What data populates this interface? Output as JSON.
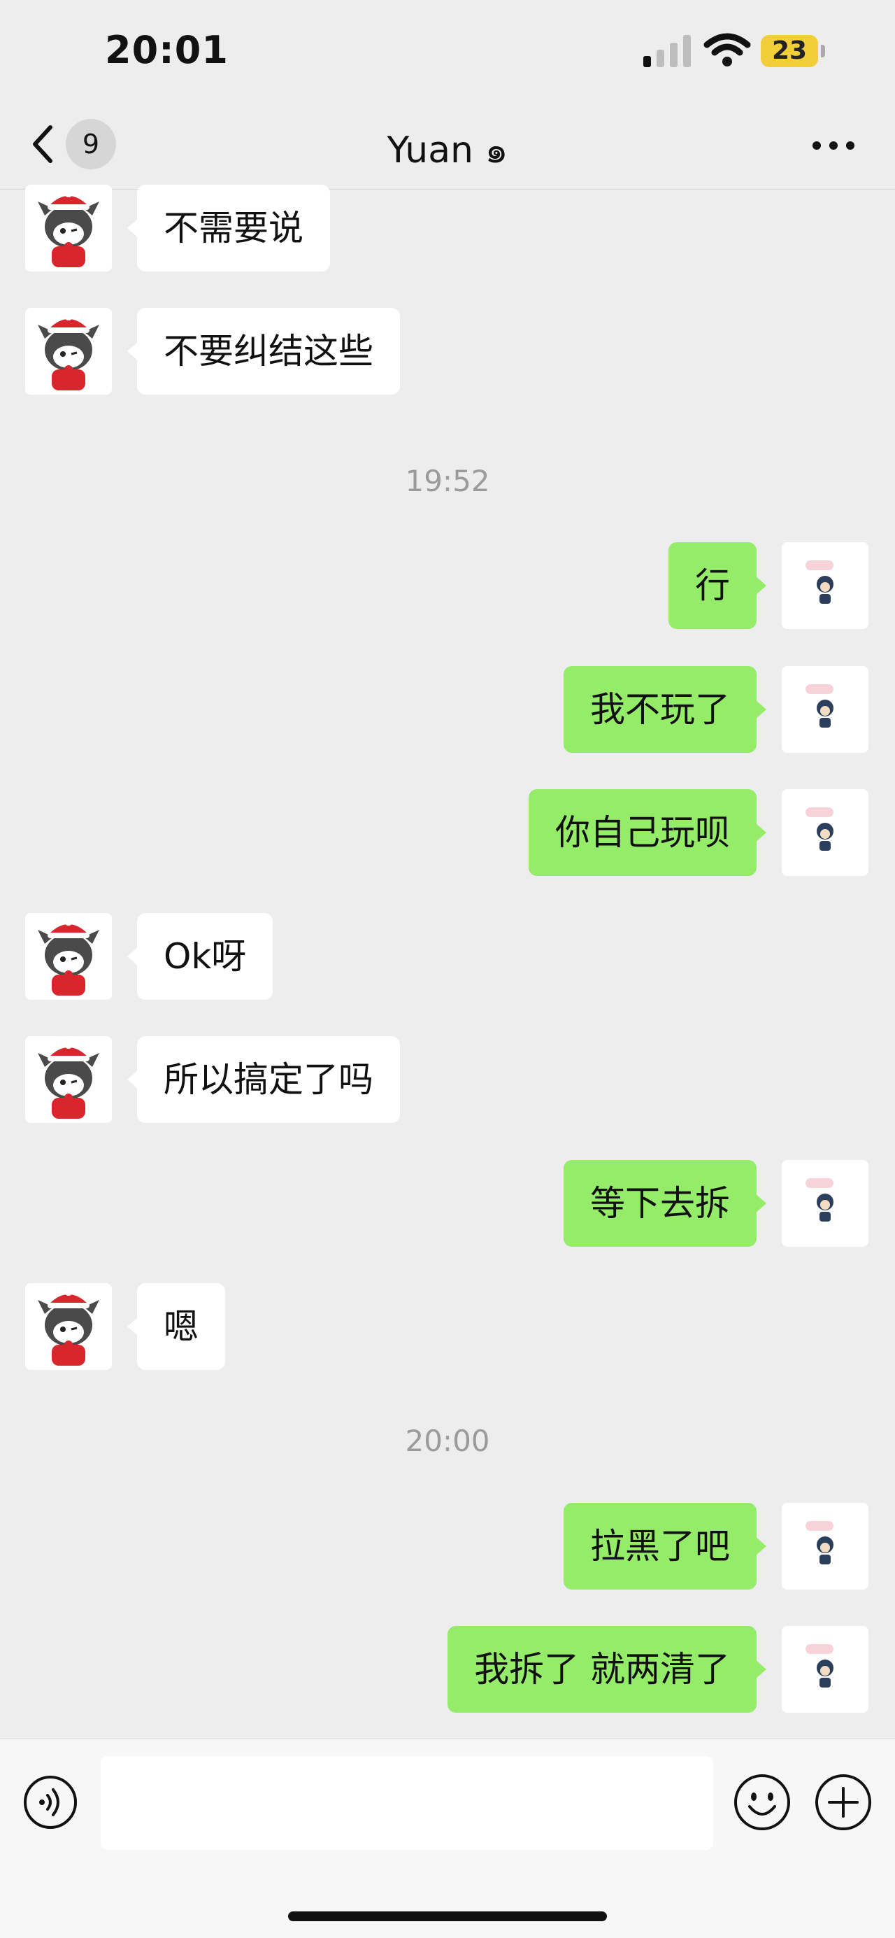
{
  "status_bar": {
    "time": "20:01",
    "battery": "23"
  },
  "navbar": {
    "unread_count": "9",
    "title": "Yuan ๑"
  },
  "messages": [
    {
      "side": "recv",
      "text": "不需要说"
    },
    {
      "side": "recv",
      "text": "不要纠结这些"
    },
    {
      "type": "time",
      "text": "19:52"
    },
    {
      "side": "sent",
      "text": "行"
    },
    {
      "side": "sent",
      "text": "我不玩了"
    },
    {
      "side": "sent",
      "text": "你自己玩呗"
    },
    {
      "side": "recv",
      "text": "Ok呀"
    },
    {
      "side": "recv",
      "text": "所以搞定了吗"
    },
    {
      "side": "sent",
      "text": "等下去拆"
    },
    {
      "side": "recv",
      "text": "嗯"
    },
    {
      "type": "time",
      "text": "20:00"
    },
    {
      "side": "sent",
      "text": "拉黑了吧"
    },
    {
      "side": "sent",
      "text": "我拆了 就两清了"
    }
  ],
  "icons": {
    "back": "chevron-left-icon",
    "more": "more-dots-icon",
    "voice": "voice-icon",
    "emoji": "emoji-icon",
    "plus": "plus-icon"
  },
  "colors": {
    "sent_bubble": "#95ec69",
    "recv_bubble": "#ffffff",
    "background": "#ededed"
  }
}
